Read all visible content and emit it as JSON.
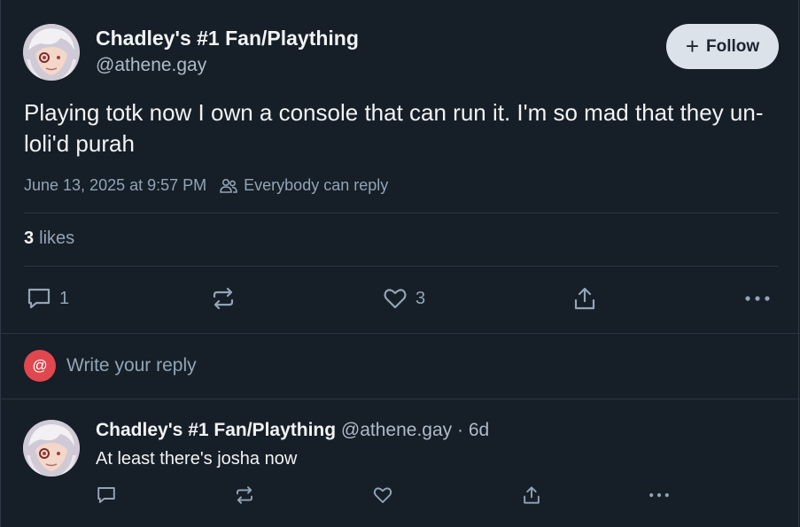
{
  "post": {
    "author_name": "Chadley's #1 Fan/Plaything",
    "author_handle": "@athene.gay",
    "follow_label": "Follow",
    "text": "Playing totk now I own a console that can run it. I'm so mad that they un-loli'd purah",
    "timestamp": "June 13, 2025 at 9:57 PM",
    "reply_setting": "Everybody can reply",
    "likes_count": "3",
    "likes_label": "likes",
    "actions": {
      "reply_count": "1",
      "like_count": "3"
    }
  },
  "composer": {
    "at_symbol": "@",
    "placeholder": "Write your reply"
  },
  "reply": {
    "author_name": "Chadley's #1 Fan/Plaything",
    "author_handle": "@athene.gay",
    "separator": "·",
    "age": "6d",
    "text": "At least there's josha now"
  },
  "colors": {
    "background": "#161e27",
    "follow_button": "#dce2ea",
    "muted_text": "#93a4b6",
    "avatar_at_badge": "#e0474f"
  }
}
